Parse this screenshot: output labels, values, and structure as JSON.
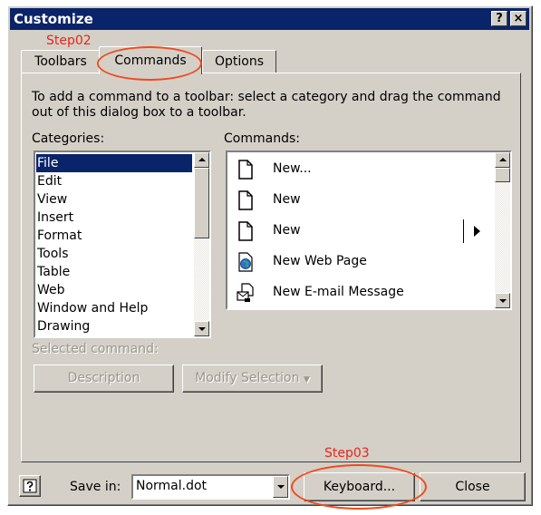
{
  "window": {
    "title": "Customize",
    "help_button": "?",
    "close_button": "×"
  },
  "tabs": [
    {
      "label": "Toolbars"
    },
    {
      "label": "Commands"
    },
    {
      "label": "Options"
    }
  ],
  "annotations": {
    "step02": "Step02",
    "step03": "Step03"
  },
  "content": {
    "instructions": "To add a command to a toolbar: select a category and drag the command out of this dialog box to a toolbar.",
    "categories_label": "Categories:",
    "commands_label": "Commands:",
    "categories": [
      "File",
      "Edit",
      "View",
      "Insert",
      "Format",
      "Tools",
      "Table",
      "Web",
      "Window and Help",
      "Drawing"
    ],
    "commands": [
      {
        "label": "New...",
        "icon": "blank-page-icon"
      },
      {
        "label": "New",
        "icon": "blank-page-icon"
      },
      {
        "label": "New",
        "icon": "blank-page-icon",
        "has_submenu": true
      },
      {
        "label": "New Web Page",
        "icon": "web-page-icon"
      },
      {
        "label": "New E-mail Message",
        "icon": "email-message-icon"
      }
    ],
    "selected_command_label": "Selected command:",
    "description_button": "Description",
    "modify_selection_button": "Modify Selection"
  },
  "footer": {
    "save_in_label": "Save in:",
    "save_in_value": "Normal.dot",
    "keyboard_button": "Keyboard...",
    "close_button": "Close"
  },
  "colors": {
    "dialog_face": "#d4d0c8",
    "title_bar": "#0a246a",
    "selection": "#0a246a",
    "annotation": "#e5261a"
  }
}
